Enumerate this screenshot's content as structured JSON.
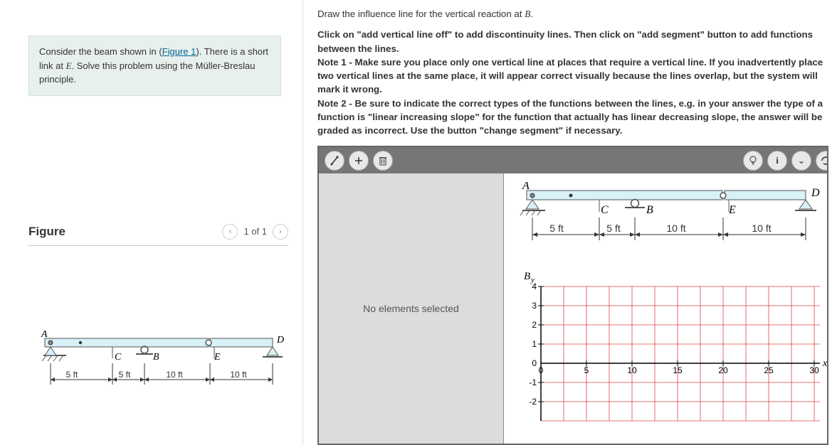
{
  "problem": {
    "prefix": "Consider the beam shown in (",
    "figure_link": "Figure 1",
    "middle": "). There is a short link at ",
    "E": "E",
    "suffix": ". Solve this problem using the Müller-Breslau principle."
  },
  "figure": {
    "title": "Figure",
    "counter": "1 of 1",
    "labels": {
      "A": "A",
      "B": "B",
      "C": "C",
      "D": "D",
      "E": "E"
    },
    "dims": {
      "d1": "5 ft",
      "d2": "5 ft",
      "d3": "10 ft",
      "d4": "10 ft"
    }
  },
  "instructions": {
    "line1_pre": "Draw the influence line for the vertical reaction at ",
    "line1_B": "B",
    "line1_post": ".",
    "line2": "Click on \"add vertical line off\" to add discontinuity lines. Then click on \"add segment\" button to add functions between the lines.",
    "note1": "Note 1 - Make sure you place only one vertical line at places that require a vertical line. If you inadvertently place two vertical lines at the same place, it will appear correct visually because the lines overlap, but the system will mark it wrong.",
    "note2": "Note 2 - Be sure to indicate the correct types of the functions between the lines, e.g. in your answer the type of a function is \"linear increasing slope\" for the function that actually has linear decreasing slope, the answer will be graded as incorrect. Use the button \"change segment\" if necessary."
  },
  "editor": {
    "no_selection": "No elements selected"
  },
  "chart_data": {
    "type": "line",
    "title": "",
    "xlabel": "x",
    "ylabel": "B_y",
    "xlim": [
      0,
      30
    ],
    "ylim": [
      -2,
      4
    ],
    "xticks": [
      0,
      5,
      10,
      15,
      20,
      25,
      30
    ],
    "yticks": [
      -2,
      -1,
      0,
      1,
      2,
      3,
      4
    ],
    "series": [],
    "grid": true
  }
}
